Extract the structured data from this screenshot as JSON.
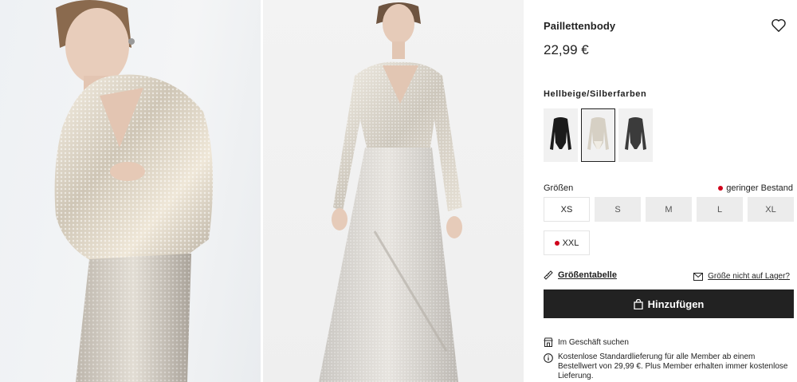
{
  "product": {
    "title": "Paillettenbody",
    "price": "22,99 €"
  },
  "color": {
    "name": "Hellbeige/Silberfarben",
    "swatches": [
      {
        "name": "schwarz",
        "color": "#1b1b1b"
      },
      {
        "name": "hellbeige-silber",
        "color": "#d9d4ca",
        "selected": true
      },
      {
        "name": "dunkelgrau",
        "color": "#3a3a3a"
      }
    ]
  },
  "sizes": {
    "label": "Größen",
    "stock_note": "geringer Bestand",
    "items": [
      {
        "label": "XS",
        "available": true,
        "low_stock": false
      },
      {
        "label": "S",
        "available": false,
        "low_stock": false
      },
      {
        "label": "M",
        "available": false,
        "low_stock": false
      },
      {
        "label": "L",
        "available": false,
        "low_stock": false
      },
      {
        "label": "XL",
        "available": false,
        "low_stock": false
      },
      {
        "label": "XXL",
        "available": true,
        "low_stock": true
      }
    ]
  },
  "links": {
    "size_chart": "Größentabelle",
    "notify": "Größe nicht auf Lager?"
  },
  "cta": {
    "add_to_bag": "Hinzufügen"
  },
  "info": {
    "store": "Im Geschäft suchen",
    "delivery": "Kostenlose Standardlieferung für alle Member ab einem Bestellwert von 29,99 €. Plus Member erhalten immer kostenlose Lieferung."
  },
  "colors": {
    "accent": "#222222",
    "low_stock": "#d0021b",
    "disabled_bg": "#ececec"
  }
}
